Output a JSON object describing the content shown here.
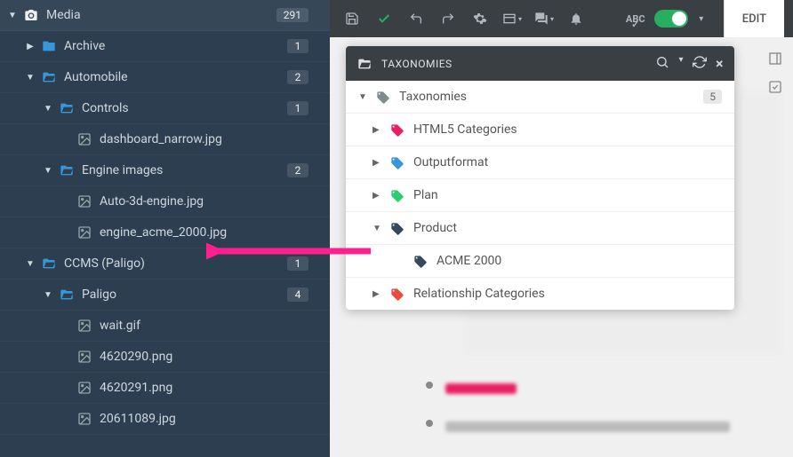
{
  "sidebar": {
    "media": {
      "label": "Media",
      "count": "291"
    },
    "archive": {
      "label": "Archive",
      "count": "1"
    },
    "automobile": {
      "label": "Automobile",
      "count": "2"
    },
    "controls": {
      "label": "Controls",
      "count": "1"
    },
    "dashboard": {
      "label": "dashboard_narrow.jpg"
    },
    "engine_images": {
      "label": "Engine images",
      "count": "2"
    },
    "auto3d": {
      "label": "Auto-3d-engine.jpg"
    },
    "engine_acme": {
      "label": "engine_acme_2000.jpg"
    },
    "ccms": {
      "label": "CCMS (Paligo)",
      "count": "1"
    },
    "paligo": {
      "label": "Paligo",
      "count": "4"
    },
    "wait": {
      "label": "wait.gif"
    },
    "img1": {
      "label": "4620290.png"
    },
    "img2": {
      "label": "4620291.png"
    },
    "img3": {
      "label": "20611089.jpg"
    }
  },
  "toolbar": {
    "edit": "EDIT"
  },
  "taxonomies": {
    "header": "TAXONOMIES",
    "root": {
      "label": "Taxonomies",
      "count": "5"
    },
    "html5": "HTML5 Categories",
    "output": "Outputformat",
    "plan": "Plan",
    "product": "Product",
    "acme": "ACME 2000",
    "relation": "Relationship Categories"
  },
  "colors": {
    "tag_gray": "#7f8c8d",
    "tag_pink": "#e91e63",
    "tag_blue": "#3498db",
    "tag_green": "#2ecc71",
    "tag_dark": "#34495e",
    "tag_red": "#e74c3c"
  }
}
